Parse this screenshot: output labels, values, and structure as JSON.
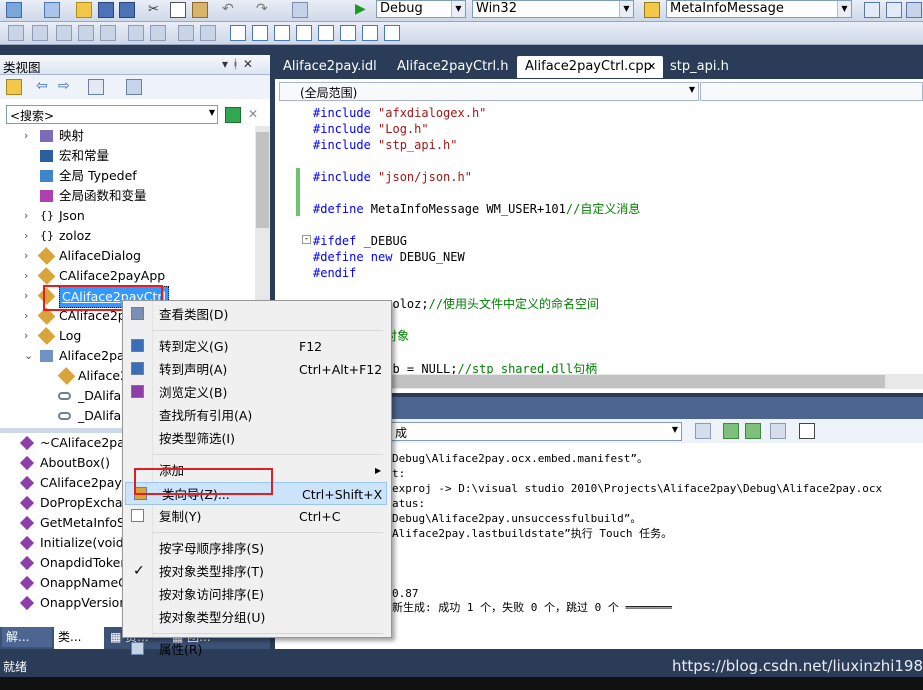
{
  "toolbar": {
    "config_dropdown": "Debug",
    "platform_dropdown": "Win32",
    "find_dropdown": "MetaInfoMessage"
  },
  "class_view": {
    "title": "类视图",
    "pin_label": "▾ ᚼ ✕",
    "search_placeholder": "<搜索>",
    "tree": [
      {
        "label": "映射",
        "icon": "map-icon"
      },
      {
        "label": "宏和常量",
        "icon": "macro-icon"
      },
      {
        "label": "全局 Typedef",
        "icon": "typedef-icon"
      },
      {
        "label": "全局函数和变量",
        "icon": "global-function-icon"
      },
      {
        "label": "Json",
        "icon": "namespace-icon"
      },
      {
        "label": "zoloz",
        "icon": "namespace-icon"
      },
      {
        "label": "AlifaceDialog",
        "icon": "class-icon"
      },
      {
        "label": "CAliface2payApp",
        "icon": "class-icon"
      },
      {
        "label": "CAliface2payCtrl",
        "icon": "class-icon"
      },
      {
        "label": "CAliface2pa",
        "icon": "class-icon"
      },
      {
        "label": "Log",
        "icon": "class-icon"
      },
      {
        "label": "Aliface2pa",
        "icon": "interface-icon"
      },
      {
        "label": "Aliface2",
        "icon": "class-icon"
      },
      {
        "label": "_DAlifac",
        "icon": "interface-icon"
      },
      {
        "label": "_DAlifac",
        "icon": "interface-icon"
      }
    ],
    "members": [
      {
        "label": "~CAliface2pay"
      },
      {
        "label": "AboutBox()"
      },
      {
        "label": "CAliface2payC"
      },
      {
        "label": "DoPropExchar"
      },
      {
        "label": "GetMetaInfoSt"
      },
      {
        "label": "Initialize(void)"
      },
      {
        "label": "OnapdidToker"
      },
      {
        "label": "OnappNameC"
      },
      {
        "label": "OnappVersion"
      }
    ],
    "bottom_tabs": [
      "解...",
      "类...",
      "▦ 资...",
      "▦ 团..."
    ]
  },
  "editor": {
    "tabs": [
      "Aliface2pay.idl",
      "Aliface2payCtrl.h",
      "Aliface2payCtrl.cpp",
      "stp_api.h"
    ],
    "scope_dropdown": "(全局范围)",
    "lines": [
      {
        "parts": [
          {
            "t": "#include ",
            "c": "kw"
          },
          {
            "t": "\"afxdialogex.h\"",
            "c": "str"
          }
        ]
      },
      {
        "parts": [
          {
            "t": "#include ",
            "c": "kw"
          },
          {
            "t": "\"Log.h\"",
            "c": "str"
          }
        ]
      },
      {
        "parts": [
          {
            "t": "#include ",
            "c": "kw"
          },
          {
            "t": "\"stp_api.h\"",
            "c": "str"
          }
        ]
      },
      {
        "parts": []
      },
      {
        "parts": [
          {
            "t": "#include ",
            "c": "kw"
          },
          {
            "t": "\"json/json.h\"",
            "c": "str"
          }
        ]
      },
      {
        "parts": []
      },
      {
        "parts": [
          {
            "t": "#define ",
            "c": "kw"
          },
          {
            "t": "MetaInfoMessage WM_USER+101",
            "c": ""
          },
          {
            "t": "//自定义消息",
            "c": "cm"
          }
        ]
      },
      {
        "parts": []
      },
      {
        "parts": [
          {
            "t": "#ifdef ",
            "c": "kw"
          },
          {
            "t": "_DEBUG",
            "c": ""
          }
        ]
      },
      {
        "parts": [
          {
            "t": "#define ",
            "c": "kw"
          },
          {
            "t": "new ",
            "c": "kw"
          },
          {
            "t": "DEBUG_NEW",
            "c": ""
          }
        ]
      },
      {
        "parts": [
          {
            "t": "#endif",
            "c": "kw"
          }
        ]
      },
      {
        "parts": []
      },
      {
        "parts": [
          {
            "t": "     pace ",
            "c": "kw"
          },
          {
            "t": "zoloz;",
            "c": ""
          },
          {
            "t": "//使用头文件中定义的命名空间",
            "c": "cm"
          }
        ]
      },
      {
        "parts": []
      },
      {
        "parts": [
          {
            "t": "     日志类对象",
            "c": "cm"
          }
        ]
      },
      {
        "parts": []
      },
      {
        "parts": [
          {
            "t": "     instLib = NULL;",
            "c": ""
          },
          {
            "t": "//stp_shared.dll句柄",
            "c": "cm"
          }
        ]
      }
    ]
  },
  "output": {
    "dropdown": "成",
    "lines": [
      "Debug\\Aliface2pay.ocx.embed.manifest”。",
      "t:",
      "exproj -> D:\\visual studio 2010\\Projects\\Aliface2pay\\Debug\\Aliface2pay.ocx",
      "atus:",
      "Debug\\Aliface2pay.unsuccessfulbuild”。",
      "Aliface2pay.lastbuildstate”执行 Touch 任务。",
      "",
      "",
      "",
      "0.87",
      "新生成: 成功 1 个，失败 0 个，跳过 0 个 ═══════"
    ]
  },
  "context_menu": {
    "items": [
      {
        "label": "查看类图(D)",
        "shortcut": "",
        "icon": "class-diagram-icon"
      },
      {
        "sep": true
      },
      {
        "label": "转到定义(G)",
        "shortcut": "F12",
        "icon": "go-to-definition-icon"
      },
      {
        "label": "转到声明(A)",
        "shortcut": "Ctrl+Alt+F12",
        "icon": "go-to-declaration-icon"
      },
      {
        "label": "浏览定义(B)",
        "shortcut": "",
        "icon": "browse-definition-icon"
      },
      {
        "label": "查找所有引用(A)",
        "shortcut": "",
        "icon": ""
      },
      {
        "label": "按类型筛选(I)",
        "shortcut": "",
        "icon": ""
      },
      {
        "sep": true
      },
      {
        "label": "添加",
        "shortcut": "",
        "icon": "",
        "submenu": true
      },
      {
        "label": "类向导(Z)...",
        "shortcut": "Ctrl+Shift+X",
        "icon": "class-wizard-icon",
        "highlight": true
      },
      {
        "label": "复制(Y)",
        "shortcut": "Ctrl+C",
        "icon": "copy-icon"
      },
      {
        "sep": true
      },
      {
        "label": "按字母顺序排序(S)",
        "shortcut": "",
        "icon": ""
      },
      {
        "label": "按对象类型排序(T)",
        "shortcut": "",
        "icon": "checkmark-icon",
        "checked": true
      },
      {
        "label": "按对象访问排序(E)",
        "shortcut": "",
        "icon": ""
      },
      {
        "label": "按对象类型分组(U)",
        "shortcut": "",
        "icon": ""
      },
      {
        "sep": true
      },
      {
        "label": "属性(R)",
        "shortcut": "",
        "icon": "properties-icon"
      }
    ]
  },
  "status_bar": {
    "text": "就绪",
    "watermark": "https://blog.csdn.net/liuxinzhi1982"
  },
  "colors": {
    "highlight_red": "#e02020",
    "selection_blue": "#3399ff",
    "title_blue": "#2b3c59"
  }
}
